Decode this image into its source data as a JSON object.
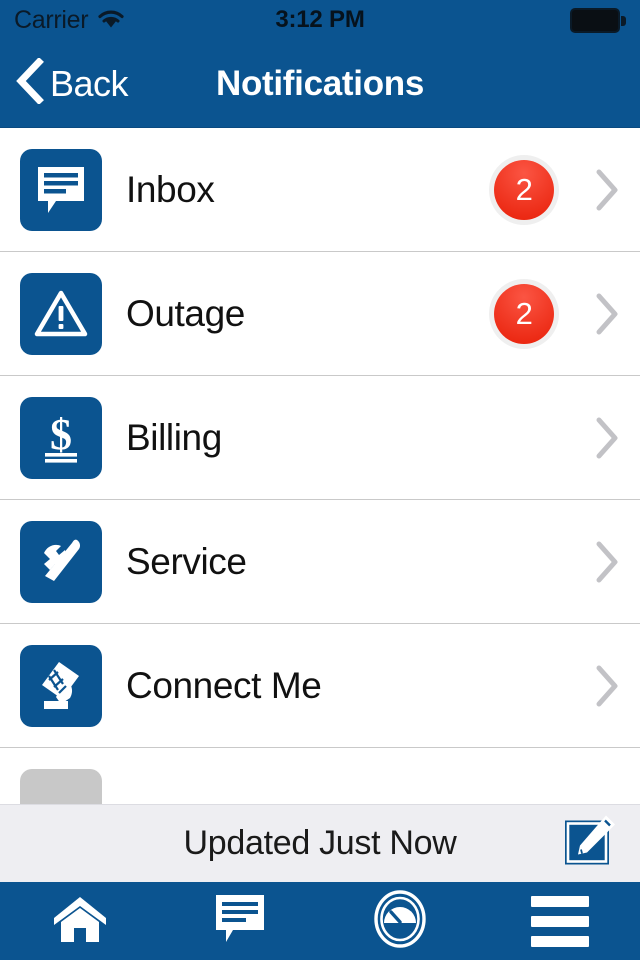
{
  "colors": {
    "brand_blue": "#0b5490",
    "badge_red": "#e81f08",
    "tile_disabled_gray": "#c8c8c8",
    "updated_bar_bg": "#eeeef2",
    "chevron_gray": "#c2c2c6",
    "separator": "#c9c9c9"
  },
  "status_bar": {
    "carrier": "Carrier",
    "wifi_icon": "wifi-icon",
    "time": "3:12 PM",
    "battery_icon": "battery-full-icon"
  },
  "nav_bar": {
    "back_icon": "chevron-left-icon",
    "back_label": "Back",
    "title": "Notifications"
  },
  "list": {
    "rows": [
      {
        "label": "Inbox",
        "icon": "inbox-message-icon",
        "badge": "2",
        "chevron": "chevron-right-icon",
        "disabled": false
      },
      {
        "label": "Outage",
        "icon": "warning-triangle-icon",
        "badge": "2",
        "chevron": "chevron-right-icon",
        "disabled": false
      },
      {
        "label": "Billing",
        "icon": "dollar-bill-icon",
        "badge": "",
        "chevron": "chevron-right-icon",
        "disabled": false
      },
      {
        "label": "Service",
        "icon": "tools-icon",
        "badge": "",
        "chevron": "chevron-right-icon",
        "disabled": false
      },
      {
        "label": "Connect Me",
        "icon": "phone-keypad-icon",
        "badge": "",
        "chevron": "chevron-right-icon",
        "disabled": false
      },
      {
        "label": "",
        "icon": "disabled-tile-icon",
        "badge": "",
        "chevron": "",
        "disabled": true
      }
    ]
  },
  "updated_bar": {
    "text": "Updated Just Now",
    "compose_icon": "compose-pencil-icon"
  },
  "tab_bar": {
    "tabs": [
      {
        "icon": "home-icon",
        "name": "tab-home"
      },
      {
        "icon": "messages-icon",
        "name": "tab-messages"
      },
      {
        "icon": "usage-gauge-icon",
        "name": "tab-usage"
      },
      {
        "icon": "hamburger-menu-icon",
        "name": "tab-menu"
      }
    ]
  }
}
